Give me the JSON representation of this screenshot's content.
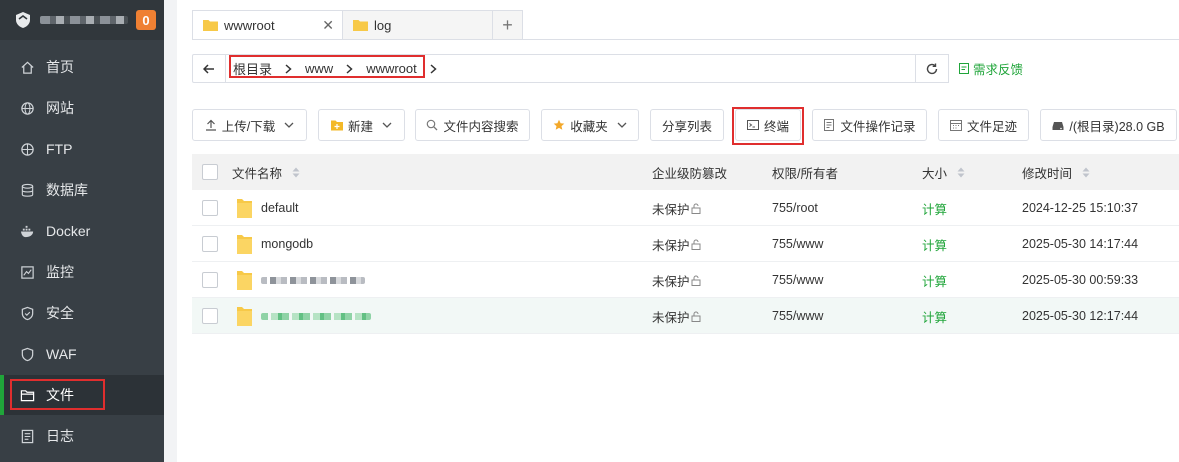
{
  "sidebar": {
    "badge": "0",
    "items": [
      {
        "label": "首页",
        "icon": "home-icon"
      },
      {
        "label": "网站",
        "icon": "globe-icon"
      },
      {
        "label": "FTP",
        "icon": "ftp-icon"
      },
      {
        "label": "数据库",
        "icon": "database-icon"
      },
      {
        "label": "Docker",
        "icon": "docker-icon"
      },
      {
        "label": "监控",
        "icon": "monitor-icon"
      },
      {
        "label": "安全",
        "icon": "shield-icon"
      },
      {
        "label": "WAF",
        "icon": "waf-icon"
      },
      {
        "label": "文件",
        "icon": "folder-icon"
      },
      {
        "label": "日志",
        "icon": "log-icon"
      }
    ]
  },
  "tabs": [
    {
      "label": "wwwroot",
      "close": "✕"
    },
    {
      "label": "log"
    }
  ],
  "tab_add": "+",
  "path": {
    "crumbs": [
      "根目录",
      "www",
      "wwwroot"
    ]
  },
  "feedback": "需求反馈",
  "toolbar": {
    "upload": "上传/下载",
    "new": "新建",
    "search": "文件内容搜索",
    "favorites": "收藏夹",
    "share": "分享列表",
    "terminal": "终端",
    "oplog": "文件操作记录",
    "footprint": "文件足迹",
    "disk": "/(根目录)28.0 GB"
  },
  "table": {
    "headers": {
      "name": "文件名称",
      "protect": "企业级防篡改",
      "perm": "权限/所有者",
      "size": "大小",
      "mtime": "修改时间"
    },
    "rows": [
      {
        "name": "default",
        "protect": "未保护",
        "perm": "755/root",
        "size": "计算",
        "mtime": "2024-12-25 15:10:37"
      },
      {
        "name": "mongodb",
        "protect": "未保护",
        "perm": "755/www",
        "size": "计算",
        "mtime": "2025-05-30 14:17:44"
      },
      {
        "name": "",
        "protect": "未保护",
        "perm": "755/www",
        "size": "计算",
        "mtime": "2025-05-30 00:59:33"
      },
      {
        "name": "",
        "protect": "未保护",
        "perm": "755/www",
        "size": "计算",
        "mtime": "2025-05-30 12:17:44"
      }
    ]
  },
  "colors": {
    "sidebar_bg": "#383f45",
    "accent_green": "#20a53a",
    "badge": "#ef8033",
    "highlight_red": "#e02e2e"
  }
}
